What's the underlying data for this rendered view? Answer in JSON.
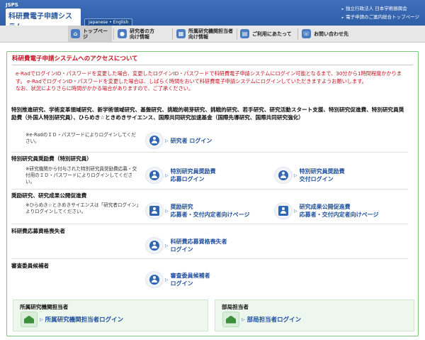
{
  "header": {
    "org_small": "JSPS",
    "system_title": "科研費電子申請システム",
    "lang_badge": "Japanese • English",
    "links": [
      "独立行政法人 日本学術振興会",
      "電子申請のご案内総合トップページ"
    ]
  },
  "nav": {
    "items": [
      {
        "label": "トップページ",
        "icon": "home-icon",
        "color": "#4a7cc3"
      },
      {
        "label": "研究者の方\n向け情報",
        "icon": "person-icon",
        "color": "#4a7cc3"
      },
      {
        "label": "所属研究機関担当者\n向け情報",
        "icon": "building-icon",
        "color": "#4a7cc3"
      },
      {
        "label": "ご利用にあたって",
        "icon": "document-icon",
        "color": "#4a7cc3"
      },
      {
        "label": "お問い合わせ先",
        "icon": "phone-icon",
        "color": "#4a7cc3"
      }
    ]
  },
  "notice": {
    "title": "科研費電子申請システムへのアクセスについて",
    "lines": [
      "e-RadでログインID・パスワードを変更した場合、変更したログインID・パスワードで科研費電子申請システムにログイン可能となるまで、30分から1時間程度かかります。 e-RadでログインID・パスワードを変更した場合は、しばらく時間をおいて科研費電子申請システムにログインしていただきますようお願いします。",
      "なお、状況によりさらに時間がかかる場合がありますので、ご了承ください。"
    ]
  },
  "sections": {
    "researcher": {
      "title": "特別推進研究、学術変革領域研究、新学術領域研究、基盤研究、挑戦的萌芽研究、挑戦的研究、若手研究、研究活動スタート支援、特別研究促進費、特別研究員奨励費（外国人特別研究員）、ひらめき☆ときめきサイエンス、国際共同研究加速基金（国際先導研究、国際共同研究強化）",
      "note": "※e-RadのＩＤ・パスワードによりログインしてください。",
      "login": "研究者 ログイン"
    },
    "fellow": {
      "title": "特別研究員奨励費（特別研究員）",
      "note": "※研究機関から付与された特別研究員奨励費応募・交付用のＩＤ・パスワードによりログインしてください。",
      "login_apply": [
        "特別研究員奨励費",
        "応募ログイン"
      ],
      "login_grant": [
        "特別研究員奨励費",
        "交付ログイン"
      ]
    },
    "promotion": {
      "title": "奨励研究、研究成果公開促進費",
      "note": "※ひらめき☆ときめきサイエンスは「研究者ログイン」よりログインしてください。",
      "login_encourage": [
        "奨励研究",
        "応募者・交付内定者向けページ"
      ],
      "login_publication": [
        "研究成果公開促進費",
        "応募者・交付内定者向けページ"
      ]
    },
    "lost_eligibility": {
      "title": "科研費応募資格喪失者",
      "login": [
        "科研費応募資格喪失者",
        "ログイン"
      ]
    },
    "reviewer": {
      "title": "審査委員候補者",
      "login": [
        "審査委員候補者",
        "ログイン"
      ]
    }
  },
  "bottom": {
    "institution": {
      "title": "所属研究機関担当者",
      "login": "所属研究機関担当者ログイン"
    },
    "department": {
      "title": "部局担当者",
      "login": "部局担当者ログイン"
    }
  }
}
